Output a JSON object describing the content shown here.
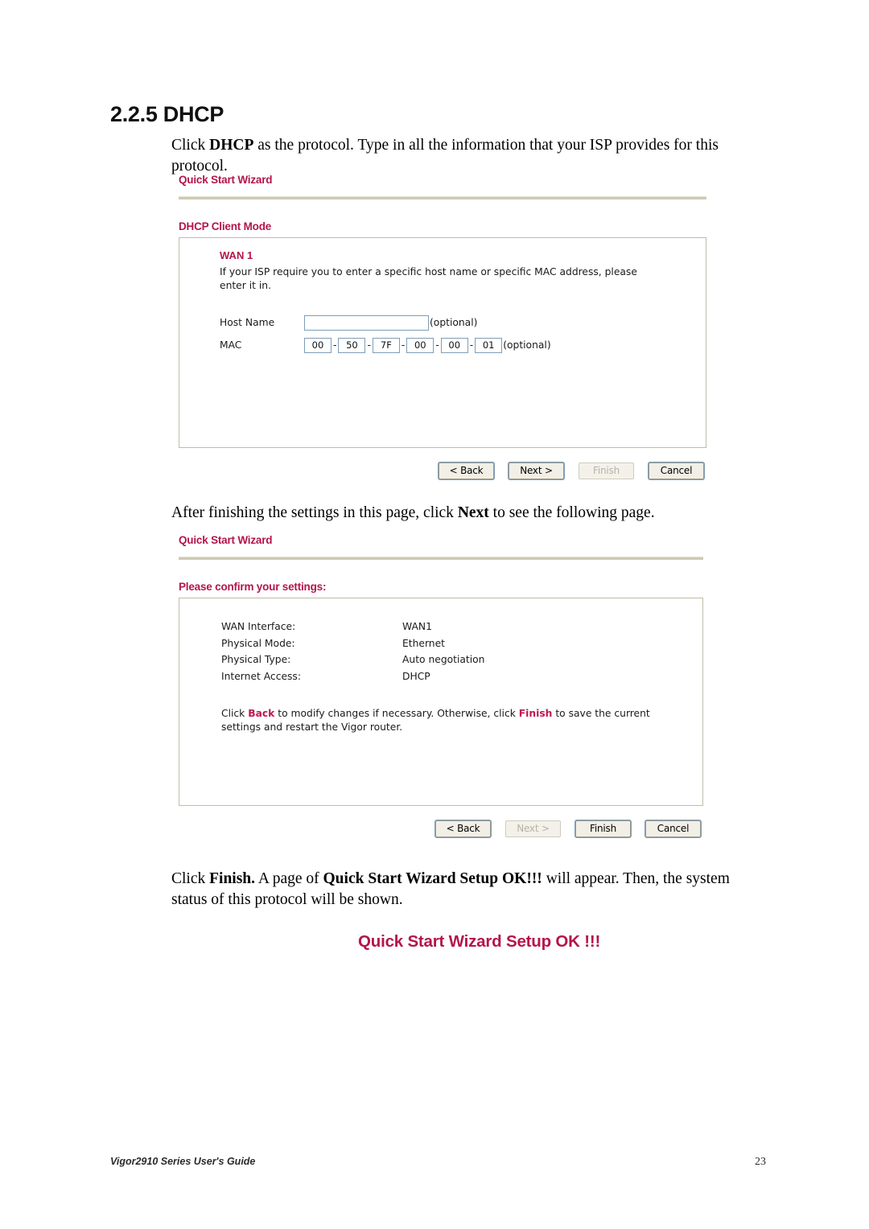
{
  "document": {
    "section_number_title": "2.2.5 DHCP",
    "footer_left": "Vigor2910 Series User's Guide",
    "footer_page": "23",
    "accent_color": "#b4154b",
    "paragraphs": {
      "intro_pre": "Click ",
      "intro_bold": "DHCP",
      "intro_post": " as the protocol. Type in all the information that your ISP provides for this protocol.",
      "mid_pre": "After finishing the settings in this page, click ",
      "mid_bold": "Next",
      "mid_post": " to see the following page.",
      "end_pre": "Click ",
      "end_bold1": "Finish.",
      "end_mid": " A page of ",
      "end_bold2": "Quick Start Wizard Setup OK!!!",
      "end_post": " will appear. Then, the system status of this protocol will be shown."
    },
    "setup_ok_banner": "Quick Start Wizard Setup OK !!!"
  },
  "wizard_dhcp": {
    "title": "Quick Start Wizard",
    "subtitle": "DHCP Client Mode",
    "wan_label": "WAN 1",
    "description": "If your ISP require you to enter a specific host name or specific MAC address, please enter it in.",
    "host_name": {
      "label": "Host Name",
      "value": "",
      "placeholder": "",
      "optional_text": "(optional)"
    },
    "mac": {
      "label": "MAC",
      "octets": [
        "00",
        "50",
        "7F",
        "00",
        "00",
        "01"
      ],
      "separator": "-",
      "optional_text": "(optional)"
    },
    "buttons": [
      {
        "label": "< Back",
        "name": "back-button",
        "disabled": false
      },
      {
        "label": "Next >",
        "name": "next-button",
        "disabled": false
      },
      {
        "label": "Finish",
        "name": "finish-button",
        "disabled": true
      },
      {
        "label": "Cancel",
        "name": "cancel-button",
        "disabled": false
      }
    ]
  },
  "wizard_confirm": {
    "title": "Quick Start Wizard",
    "subtitle": "Please confirm your settings:",
    "settings": [
      {
        "key": "WAN Interface:",
        "value": "WAN1"
      },
      {
        "key": "Physical Mode:",
        "value": "Ethernet"
      },
      {
        "key": "Physical Type:",
        "value": "Auto negotiation"
      },
      {
        "key": "Internet Access:",
        "value": "DHCP"
      }
    ],
    "note": {
      "pre": "Click ",
      "kw1": "Back",
      "mid": " to modify changes if necessary. Otherwise, click ",
      "kw2": "Finish",
      "post": " to save the current settings and restart the Vigor router."
    },
    "buttons": [
      {
        "label": "< Back",
        "name": "back-button",
        "disabled": false
      },
      {
        "label": "Next >",
        "name": "next-button",
        "disabled": true
      },
      {
        "label": "Finish",
        "name": "finish-button",
        "disabled": false
      },
      {
        "label": "Cancel",
        "name": "cancel-button",
        "disabled": false
      }
    ]
  }
}
